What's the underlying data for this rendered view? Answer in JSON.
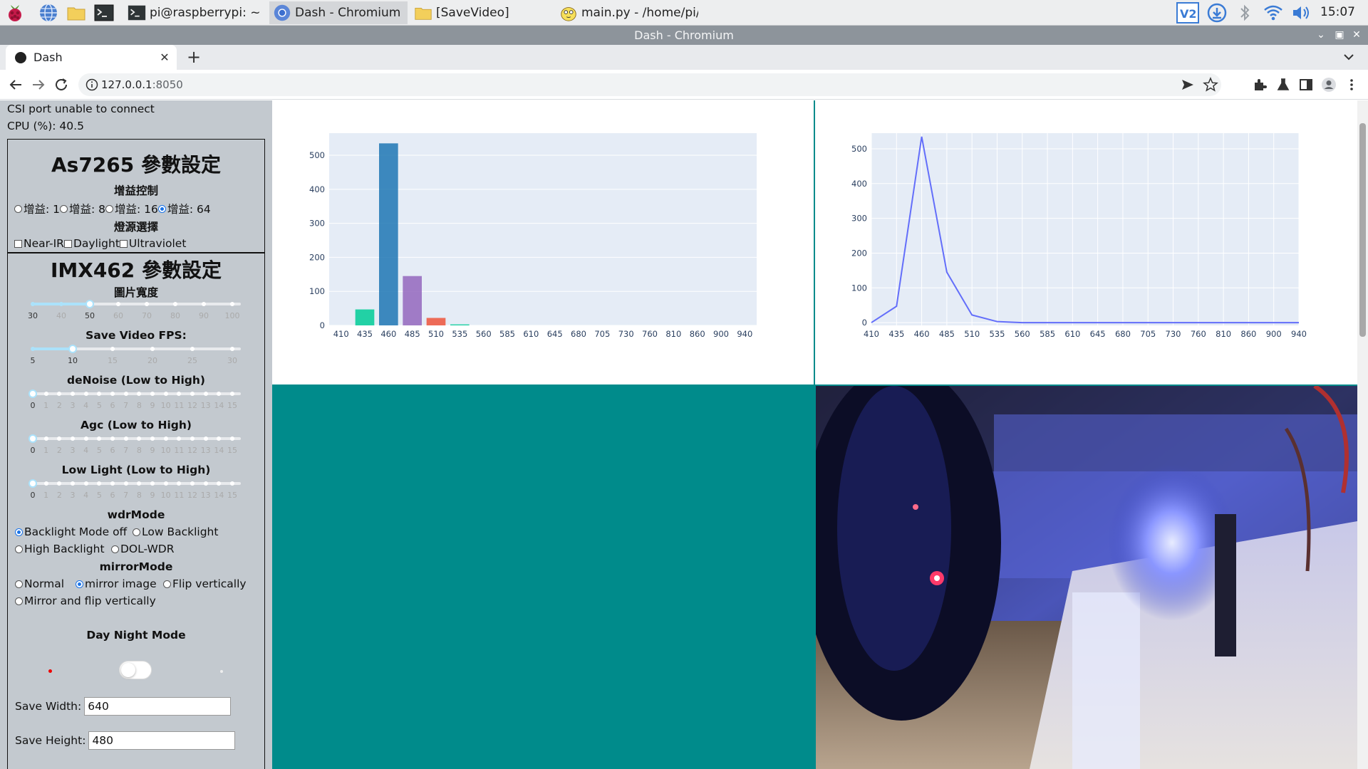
{
  "taskbar": {
    "tasks": [
      {
        "label": "pi@raspberrypi: ~"
      },
      {
        "label": "Dash - Chromium"
      },
      {
        "label": "[SaveVideo]"
      },
      {
        "label": "main.py - /home/pi/..."
      }
    ],
    "clock": "15:07"
  },
  "window": {
    "title": "Dash - Chromium"
  },
  "browser": {
    "tab_title": "Dash",
    "url_host": "127.0.0.1",
    "url_port": ":8050"
  },
  "status": {
    "line1": "CSI port unable to connect",
    "line2": "CPU (%): 40.5"
  },
  "as7265": {
    "title": "As7265 參數設定",
    "gain_label": "增益控制",
    "gains": [
      {
        "label": "增益: 1",
        "checked": false
      },
      {
        "label": "增益: 8",
        "checked": false
      },
      {
        "label": "增益: 16",
        "checked": false
      },
      {
        "label": "增益: 64",
        "checked": true
      }
    ],
    "light_label": "燈源選擇",
    "lights": [
      "Near-IR",
      "Daylight",
      "Ultraviolet"
    ]
  },
  "imx462": {
    "title": "IMX462 參數設定",
    "width_label": "圖片寬度",
    "width_ticks": [
      "30",
      "40",
      "50",
      "60",
      "70",
      "80",
      "90",
      "100"
    ],
    "width_value": 50,
    "fps_label": "Save Video FPS:",
    "fps_ticks": [
      "5",
      "10",
      "15",
      "20",
      "25",
      "30"
    ],
    "fps_value": 10,
    "denoise_label": "deNoise (Low to High)",
    "agc_label": "Agc (Low to High)",
    "lowlight_label": "Low Light (Low to High)",
    "level_ticks": [
      "0",
      "1",
      "2",
      "3",
      "4",
      "5",
      "6",
      "7",
      "8",
      "9",
      "10",
      "11",
      "12",
      "13",
      "14",
      "15"
    ],
    "denoise_value": 0,
    "agc_value": 0,
    "lowlight_value": 0,
    "wdr_label": "wdrMode",
    "wdr_options": [
      {
        "label": "Backlight Mode off",
        "checked": true
      },
      {
        "label": "Low Backlight",
        "checked": false
      },
      {
        "label": "High Backlight",
        "checked": false
      },
      {
        "label": "DOL-WDR",
        "checked": false
      }
    ],
    "mirror_label": "mirrorMode",
    "mirror_options": [
      {
        "label": "Normal",
        "checked": false
      },
      {
        "label": "mirror image",
        "checked": true
      },
      {
        "label": "Flip vertically",
        "checked": false
      },
      {
        "label": "Mirror and flip vertically",
        "checked": false
      }
    ],
    "daynight_label": "Day Night Mode",
    "save_width_label": "Save Width:",
    "save_width_value": "640",
    "save_height_label": "Save Height:",
    "save_height_value": "480"
  },
  "chart_data": [
    {
      "type": "bar",
      "categories": [
        "410",
        "435",
        "460",
        "485",
        "510",
        "535",
        "560",
        "585",
        "610",
        "645",
        "680",
        "705",
        "730",
        "760",
        "810",
        "860",
        "900",
        "940"
      ],
      "values": [
        0,
        47,
        535,
        145,
        22,
        3,
        0,
        0,
        0,
        0,
        0,
        0,
        0,
        0,
        0,
        0,
        0,
        0
      ],
      "colors": [
        "#636efa",
        "#00cc96",
        "#1f77b4",
        "#9467bd",
        "#ef553b",
        "#00cc96",
        "#636efa",
        "#636efa",
        "#636efa",
        "#636efa",
        "#636efa",
        "#636efa",
        "#636efa",
        "#636efa",
        "#636efa",
        "#636efa",
        "#636efa",
        "#636efa"
      ],
      "yticks": [
        "0",
        "100",
        "200",
        "300",
        "400",
        "500"
      ],
      "ylim": [
        0,
        565
      ],
      "grid": true
    },
    {
      "type": "line",
      "categories": [
        "410",
        "435",
        "460",
        "485",
        "510",
        "535",
        "560",
        "585",
        "610",
        "645",
        "680",
        "705",
        "730",
        "760",
        "810",
        "860",
        "900",
        "940"
      ],
      "values": [
        0,
        47,
        535,
        145,
        22,
        3,
        0,
        0,
        0,
        0,
        0,
        0,
        0,
        0,
        0,
        0,
        0,
        0
      ],
      "color": "#636efa",
      "yticks": [
        "0",
        "100",
        "200",
        "300",
        "400",
        "500"
      ],
      "ylim": [
        -8,
        545
      ],
      "grid": true
    }
  ]
}
